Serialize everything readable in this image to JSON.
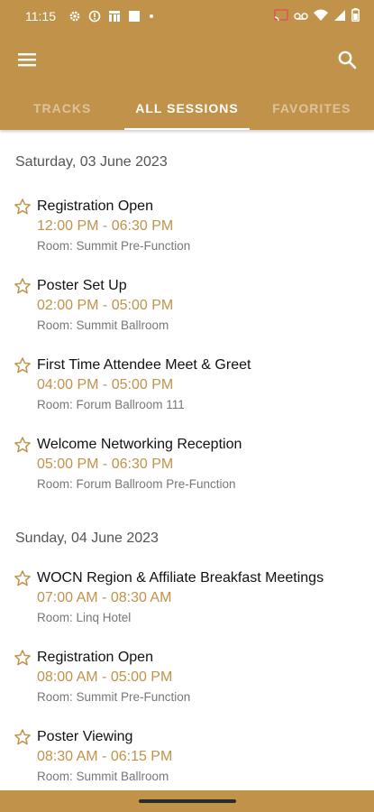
{
  "status_bar": {
    "time": "11:15",
    "left_icons": [
      "gear-icon",
      "alert-circle-icon",
      "app-notification-icon",
      "square-notification-icon",
      "dot-icon"
    ],
    "right_icons": [
      "cast-icon",
      "voicemail-icon",
      "wifi-icon",
      "signal-icon",
      "battery-icon"
    ]
  },
  "app_bar": {
    "menu_icon": "menu-icon",
    "search_icon": "search-icon"
  },
  "tabs": [
    {
      "label": "TRACKS",
      "active": false
    },
    {
      "label": "ALL SESSIONS",
      "active": true
    },
    {
      "label": "FAVORITES",
      "active": false
    }
  ],
  "days": [
    {
      "date": "Saturday, 03 June 2023",
      "sessions": [
        {
          "title": "Registration Open",
          "time": "12:00 PM - 06:30 PM",
          "room": "Room: Summit Pre-Function"
        },
        {
          "title": "Poster Set Up",
          "time": "02:00 PM - 05:00 PM",
          "room": "Room: Summit Ballroom"
        },
        {
          "title": "First Time Attendee Meet & Greet",
          "time": "04:00 PM - 05:00 PM",
          "room": "Room: Forum Ballroom 111"
        },
        {
          "title": "Welcome Networking Reception",
          "time": "05:00 PM - 06:30 PM",
          "room": "Room: Forum Ballroom Pre-Function"
        }
      ]
    },
    {
      "date": "Sunday, 04 June 2023",
      "sessions": [
        {
          "title": "WOCN Region & Affiliate Breakfast Meetings",
          "time": "07:00 AM - 08:30 AM",
          "room": "Room: Linq Hotel"
        },
        {
          "title": "Registration Open",
          "time": "08:00 AM - 05:00 PM",
          "room": "Room: Summit Pre-Function"
        },
        {
          "title": "Poster Viewing",
          "time": "08:30 AM - 06:15 PM",
          "room": "Room: Summit Ballroom"
        }
      ]
    }
  ],
  "colors": {
    "brand": "#c1924a",
    "title_text": "#111111",
    "room_text": "#777777"
  }
}
